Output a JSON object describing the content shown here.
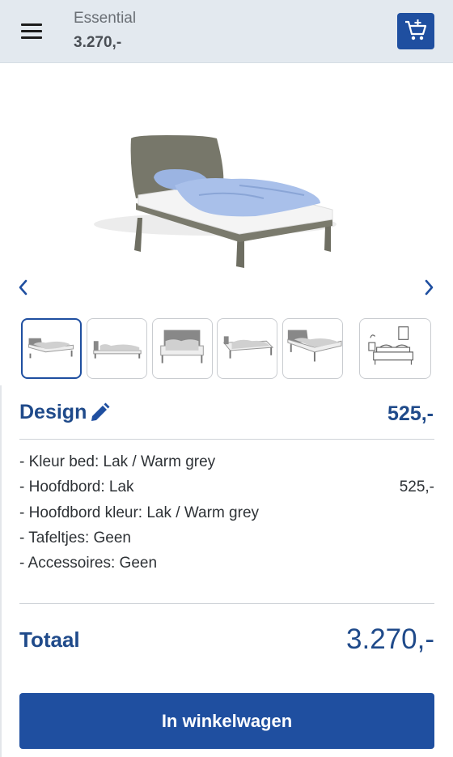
{
  "header": {
    "product_name": "Essential",
    "product_price": "3.270,-"
  },
  "colors": {
    "accent": "#1f4fa0",
    "heading": "#1f4a8a",
    "header_bg": "#e3e9ef"
  },
  "design": {
    "title": "Design",
    "price": "525,-",
    "options": [
      {
        "label": "- Kleur bed: Lak / Warm grey",
        "price": ""
      },
      {
        "label": "- Hoofdbord: Lak",
        "price": "525,-"
      },
      {
        "label": "- Hoofdbord kleur: Lak / Warm grey",
        "price": ""
      },
      {
        "label": "- Tafeltjes: Geen",
        "price": ""
      },
      {
        "label": "- Accessoires: Geen",
        "price": ""
      }
    ]
  },
  "total": {
    "label": "Totaal",
    "value": "3.270,-"
  },
  "cta": {
    "label": "In winkelwagen"
  }
}
